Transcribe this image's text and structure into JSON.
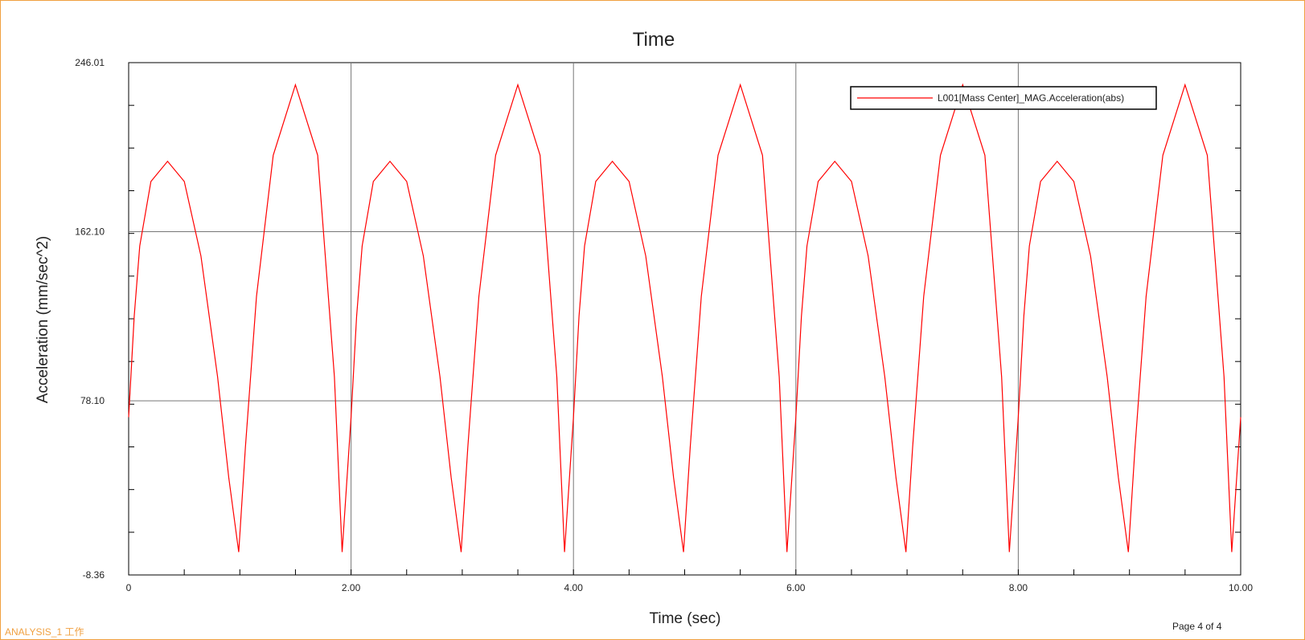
{
  "chart_data": {
    "type": "line",
    "title": "Time",
    "xlabel": "Time (sec)",
    "ylabel": "Acceleration (mm/sec^2)",
    "xlim": [
      0,
      10
    ],
    "ylim": [
      -8.36,
      246.01
    ],
    "x_ticks": [
      "0",
      "2.00",
      "4.00",
      "6.00",
      "8.00",
      "10.00"
    ],
    "y_ticks": [
      "246.01",
      "162.10",
      "78.10",
      "-8.36"
    ],
    "grid": true,
    "legend_position": "top-right",
    "series": [
      {
        "name": "L001[Mass Center]_MAG.Acceleration(abs)",
        "color": "#ff0000",
        "x": [
          0,
          0.05,
          0.1,
          0.2,
          0.35,
          0.5,
          0.65,
          0.8,
          0.9,
          0.99,
          1.05,
          1.15,
          1.3,
          1.5,
          1.7,
          1.85,
          1.92,
          2.0,
          2.05,
          2.1,
          2.2,
          2.35,
          2.5,
          2.65,
          2.8,
          2.9,
          2.99,
          3.05,
          3.15,
          3.3,
          3.5,
          3.7,
          3.85,
          3.92,
          4.0,
          4.05,
          4.1,
          4.2,
          4.35,
          4.5,
          4.65,
          4.8,
          4.9,
          4.99,
          5.05,
          5.15,
          5.3,
          5.5,
          5.7,
          5.85,
          5.92,
          6.0,
          6.05,
          6.1,
          6.2,
          6.35,
          6.5,
          6.65,
          6.8,
          6.9,
          6.99,
          7.05,
          7.15,
          7.3,
          7.5,
          7.7,
          7.85,
          7.92,
          8.0,
          8.05,
          8.1,
          8.2,
          8.35,
          8.5,
          8.65,
          8.8,
          8.9,
          8.99,
          9.05,
          9.15,
          9.3,
          9.5,
          9.7,
          9.85,
          9.92,
          10.0
        ],
        "y": [
          70,
          120,
          155,
          187,
          197,
          187,
          150,
          90,
          40,
          3,
          55,
          130,
          200,
          235,
          200,
          90,
          3,
          70,
          120,
          155,
          187,
          197,
          187,
          150,
          90,
          40,
          3,
          55,
          130,
          200,
          235,
          200,
          90,
          3,
          70,
          120,
          155,
          187,
          197,
          187,
          150,
          90,
          40,
          3,
          55,
          130,
          200,
          235,
          200,
          90,
          3,
          70,
          120,
          155,
          187,
          197,
          187,
          150,
          90,
          40,
          3,
          55,
          130,
          200,
          235,
          200,
          90,
          3,
          70,
          120,
          155,
          187,
          197,
          187,
          150,
          90,
          40,
          3,
          55,
          130,
          200,
          235,
          200,
          90,
          3,
          70
        ]
      }
    ]
  },
  "footer": {
    "analysis_label": "ANALYSIS_1 工作",
    "page_label": "Page 4 of 4"
  }
}
